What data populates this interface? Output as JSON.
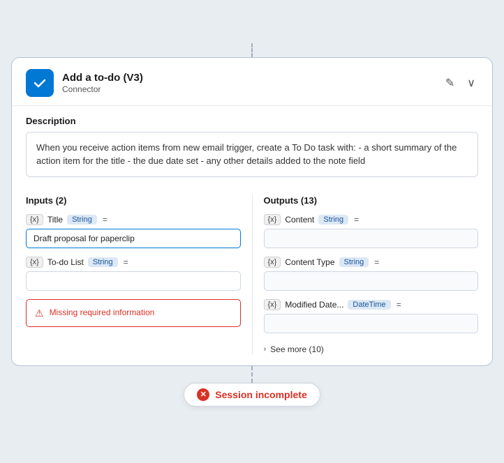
{
  "header": {
    "app_icon_alt": "To-Do checkmark icon",
    "title": "Add a to-do (V3)",
    "subtitle": "Connector",
    "edit_icon": "✎",
    "collapse_icon": "∨"
  },
  "description": {
    "label": "Description",
    "text": "When you receive action items from new email trigger, create a To Do task with: - a short summary of the action item for the title - the due date set - any other details added to the note field"
  },
  "inputs": {
    "heading": "Inputs (2)",
    "fields": [
      {
        "var_badge": "{x}",
        "label": "Title",
        "type": "String",
        "equals": "=",
        "value": "Draft proposal for paperclip",
        "has_value": true
      },
      {
        "var_badge": "{x}",
        "label": "To-do List",
        "type": "String",
        "equals": "=",
        "value": "",
        "has_value": false
      }
    ],
    "error": {
      "text": "Missing required information"
    }
  },
  "outputs": {
    "heading": "Outputs (13)",
    "fields": [
      {
        "var_badge": "{x}",
        "label": "Content",
        "type": "String",
        "equals": "=",
        "value": ""
      },
      {
        "var_badge": "{x}",
        "label": "Content Type",
        "type": "String",
        "equals": "=",
        "value": ""
      },
      {
        "var_badge": "{x}",
        "label": "Modified Date...",
        "type": "DateTime",
        "equals": "=",
        "value": ""
      }
    ],
    "see_more": "See more (10)"
  },
  "session": {
    "text": "Session incomplete"
  }
}
